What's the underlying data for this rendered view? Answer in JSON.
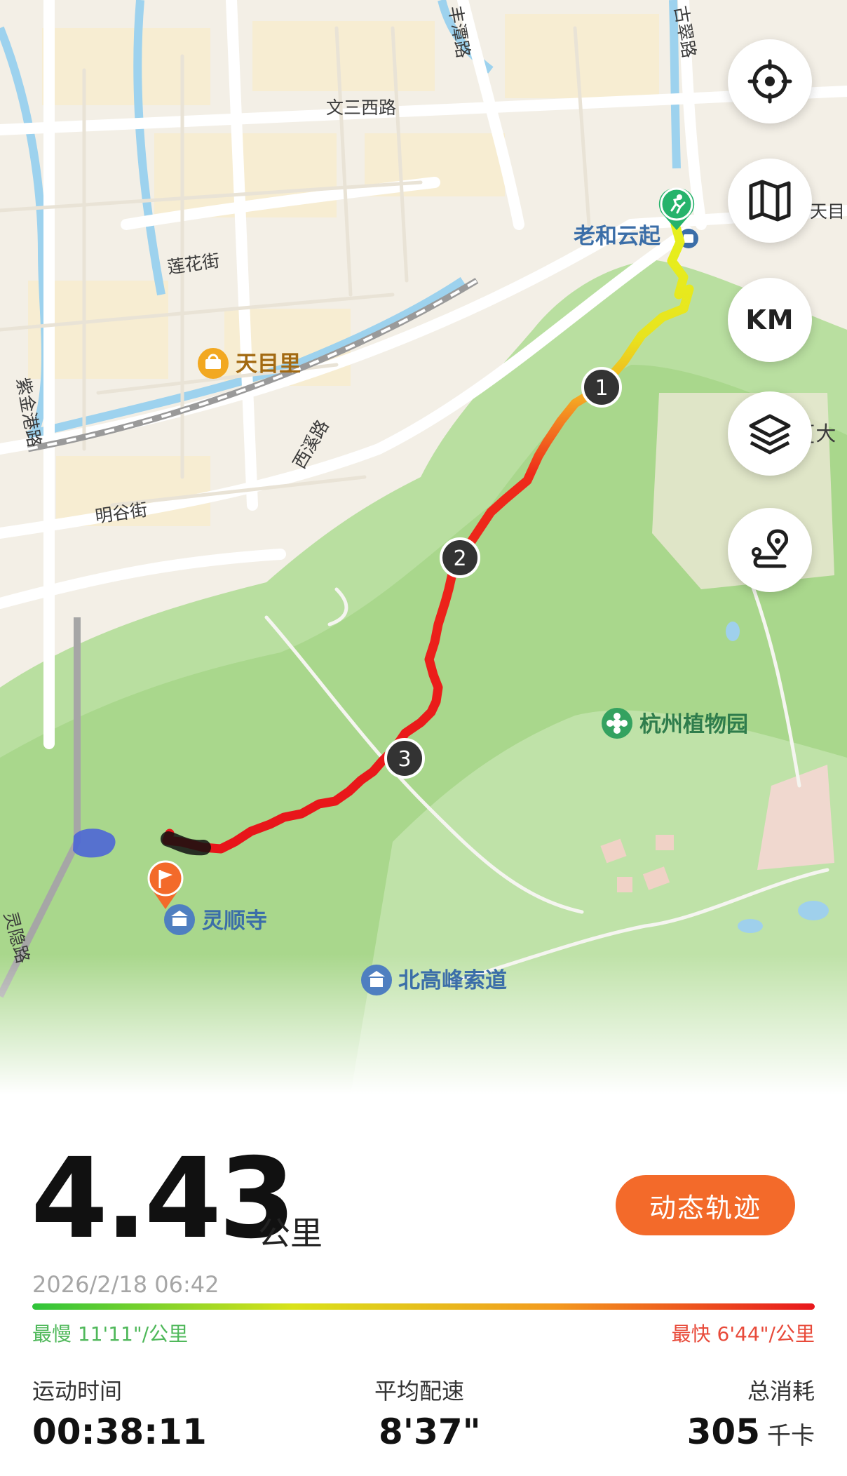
{
  "map": {
    "labels": {
      "road_wensan": "文三西路",
      "road_fengtan": "丰潭路",
      "road_gucui": "古翠路",
      "road_lianhua": "莲花街",
      "road_zijingang": "紫金港路",
      "road_xixi": "西溪路",
      "road_minggu": "明谷街",
      "road_lingyin": "灵隐路",
      "road_tianmu_edge": "天目",
      "poi_laohe": "老和云起",
      "poi_tianmuli": "天目里",
      "poi_botanical": "杭州植物园",
      "poi_lingshun": "灵顺寺",
      "poi_beigaofeng": "北高峰索道",
      "poi_edge_da": "[大"
    },
    "km_markers": [
      "1",
      "2",
      "3"
    ],
    "start_icon": "runner-icon",
    "end_icon": "flag-icon"
  },
  "controls": {
    "locate_icon": "crosshair-icon",
    "map_icon": "map-icon",
    "km_label": "KM",
    "layers_icon": "layers-icon",
    "route_icon": "route-pin-icon"
  },
  "summary": {
    "distance": "4.43",
    "distance_unit": "公里",
    "replay_label": "动态轨迹",
    "datetime": "2026/2/18 06:42",
    "slowest": "最慢 11'11\"/公里",
    "fastest": "最快 6'44\"/公里",
    "pace_colors": [
      "#2fc43a",
      "#d9e21a",
      "#f39a1f",
      "#e8171d"
    ]
  },
  "stats": {
    "duration_label": "运动时间",
    "duration_value": "00:38:11",
    "pace_label": "平均配速",
    "pace_value": "8'37\"",
    "calories_label": "总消耗",
    "calories_value": "305",
    "calories_unit": "千卡"
  }
}
